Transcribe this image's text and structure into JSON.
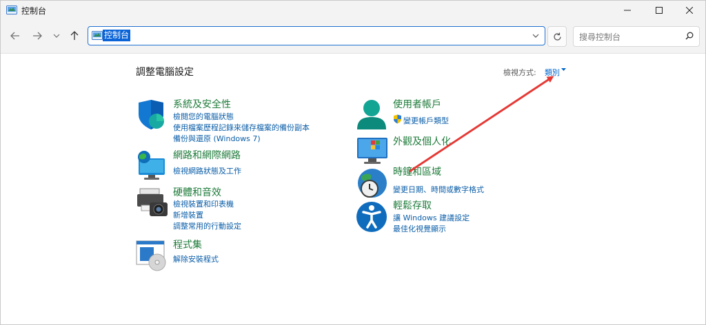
{
  "window": {
    "title": "控制台"
  },
  "toolbar": {
    "address": "控制台",
    "search_placeholder": "搜尋控制台"
  },
  "main": {
    "title": "調整電腦設定",
    "view_by_label": "檢視方式:",
    "view_by_value": "類別"
  },
  "categories": {
    "system_security": {
      "title": "系統及安全性",
      "links": [
        "檢閱您的電腦狀態",
        "使用檔案歷程記錄來儲存檔案的備份副本",
        "備份與還原 (Windows 7)"
      ]
    },
    "network": {
      "title": "網路和網際網路",
      "links": [
        "檢視網路狀態及工作"
      ]
    },
    "hardware": {
      "title": "硬體和音效",
      "links": [
        "檢視裝置和印表機",
        "新增裝置",
        "調整常用的行動設定"
      ]
    },
    "programs": {
      "title": "程式集",
      "links": [
        "解除安裝程式"
      ]
    },
    "user_accounts": {
      "title": "使用者帳戶",
      "links": [
        "變更帳戶類型"
      ]
    },
    "appearance": {
      "title": "外觀及個人化"
    },
    "clock_region": {
      "title": "時鐘和區域",
      "links": [
        "變更日期、時間或數字格式"
      ]
    },
    "ease_of_access": {
      "title": "輕鬆存取",
      "links": [
        "讓 Windows 建議設定",
        "最佳化視覺顯示"
      ]
    }
  },
  "colors": {
    "category_title": "#1e7b3a",
    "link": "#0b5ea8",
    "accent": "#0a64d8",
    "annotation_arrow": "#e53935"
  }
}
